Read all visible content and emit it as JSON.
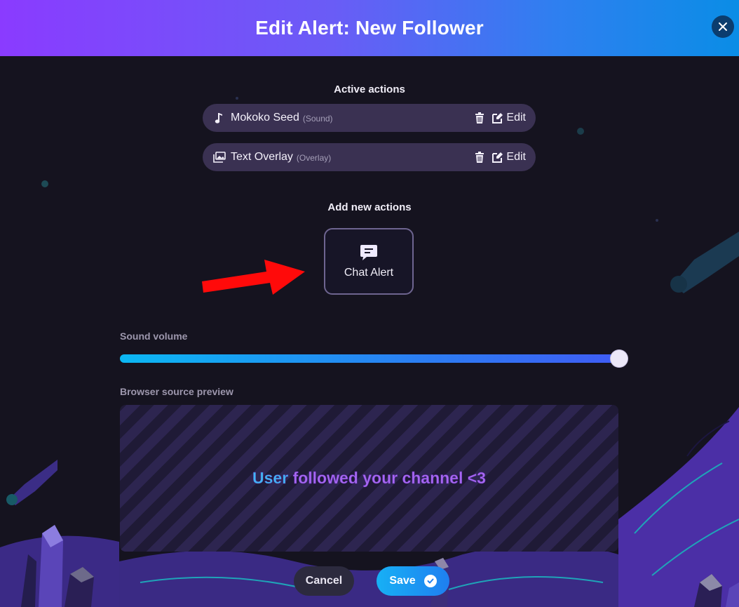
{
  "header": {
    "title": "Edit Alert: New Follower",
    "close_icon": "close-icon"
  },
  "active_actions": {
    "title": "Active actions",
    "items": [
      {
        "name": "Mokoko Seed",
        "type": "(Sound)",
        "icon": "music-note-icon",
        "edit_label": "Edit"
      },
      {
        "name": "Text Overlay",
        "type": "(Overlay)",
        "icon": "image-overlay-icon",
        "edit_label": "Edit"
      }
    ]
  },
  "add_actions": {
    "title": "Add new actions",
    "options": [
      {
        "label": "Chat Alert",
        "icon": "chat-bubble-icon"
      }
    ]
  },
  "volume": {
    "label": "Sound volume",
    "value_fraction": 1.0
  },
  "preview": {
    "label": "Browser source preview",
    "user": "User",
    "message": "followed your channel <3"
  },
  "footer": {
    "cancel_label": "Cancel",
    "save_label": "Save"
  },
  "colors": {
    "accent_purple": "#8a3bff",
    "accent_blue": "#0a8de6",
    "row_bg": "#3a3152",
    "annotation_arrow": "#ff0a0a"
  }
}
